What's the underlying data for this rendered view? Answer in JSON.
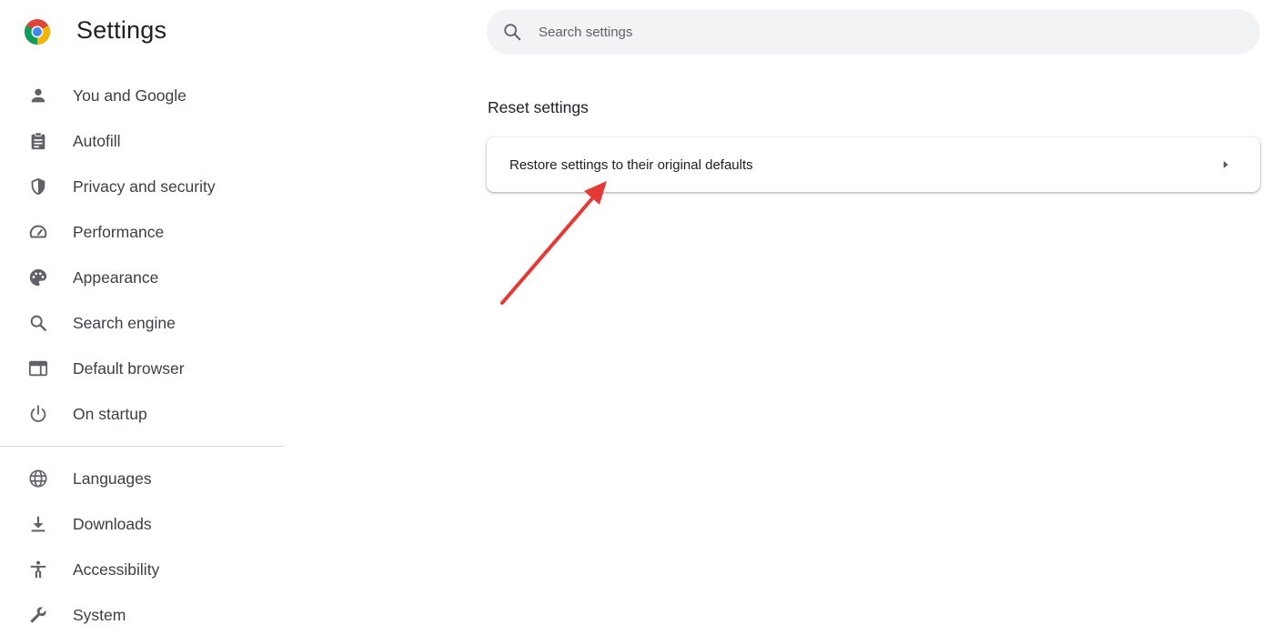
{
  "header": {
    "title": "Settings"
  },
  "search": {
    "placeholder": "Search settings"
  },
  "sidebar": {
    "primary_items": [
      {
        "label": "You and Google",
        "icon": "person-icon"
      },
      {
        "label": "Autofill",
        "icon": "clipboard-icon"
      },
      {
        "label": "Privacy and security",
        "icon": "shield-icon"
      },
      {
        "label": "Performance",
        "icon": "speedometer-icon"
      },
      {
        "label": "Appearance",
        "icon": "palette-icon"
      },
      {
        "label": "Search engine",
        "icon": "search-icon"
      },
      {
        "label": "Default browser",
        "icon": "browser-window-icon"
      },
      {
        "label": "On startup",
        "icon": "power-icon"
      }
    ],
    "secondary_items": [
      {
        "label": "Languages",
        "icon": "globe-icon"
      },
      {
        "label": "Downloads",
        "icon": "download-icon"
      },
      {
        "label": "Accessibility",
        "icon": "accessibility-icon"
      },
      {
        "label": "System",
        "icon": "wrench-icon"
      }
    ]
  },
  "main": {
    "section_title": "Reset settings",
    "card_label": "Restore settings to their original defaults"
  },
  "colors": {
    "icon": "#5f6368",
    "annotation_arrow": "#e53935",
    "search_bg": "#f1f3f4"
  }
}
